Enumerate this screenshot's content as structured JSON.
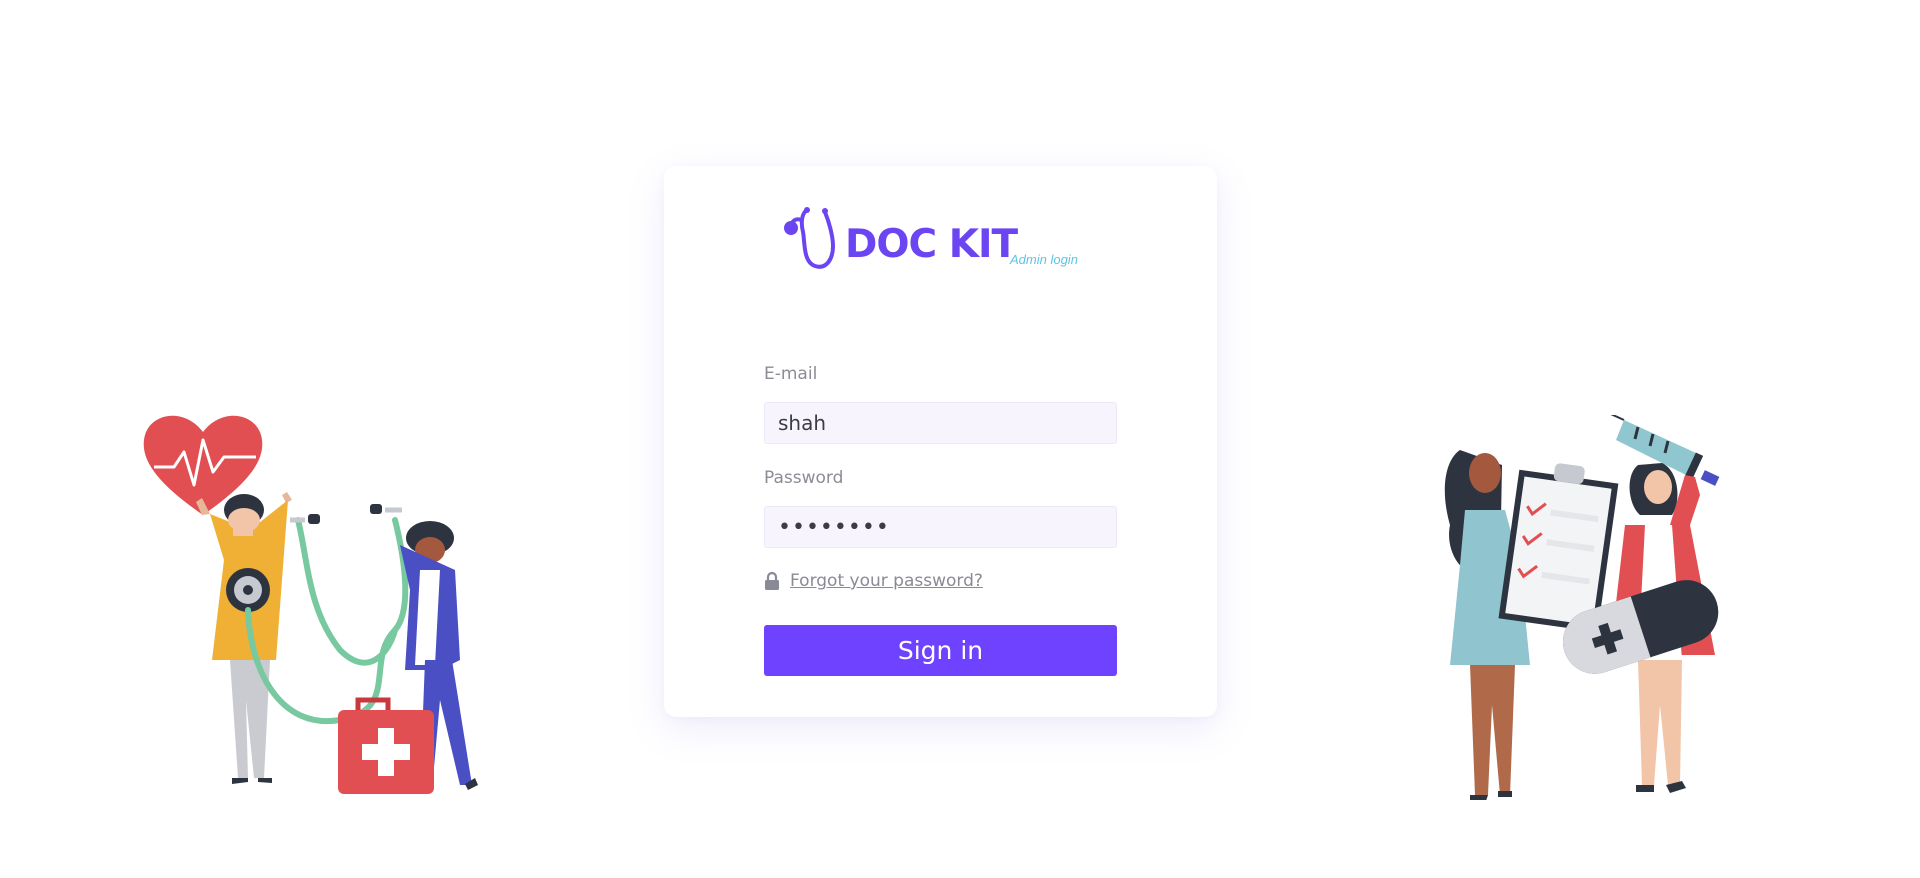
{
  "brand": {
    "name": "DOC KIT",
    "tagline": "Admin login",
    "color": "#6b45f2",
    "tagline_color": "#5cc4e6"
  },
  "form": {
    "email_label": "E-mail",
    "email_value": "shah",
    "password_label": "Password",
    "password_value": "••••••••",
    "forgot_label": "Forgot your password?",
    "signin_label": "Sign in"
  },
  "colors": {
    "accent": "#6f42ff",
    "field_bg": "#f7f4fe",
    "label": "#8c8c96"
  },
  "icons": {
    "logo": "stethoscope-icon",
    "forgot": "lock-icon"
  }
}
